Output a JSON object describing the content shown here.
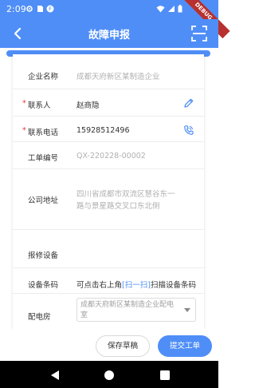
{
  "status_bar": {
    "time": "2:09",
    "icons": [
      "gear-icon",
      "sim-icon",
      "notification-app-icon",
      "wifi-icon",
      "signal-icon",
      "battery-icon"
    ],
    "debug_banner": "DEBUG"
  },
  "appbar": {
    "title": "故障申报",
    "background": "#4f8ef7"
  },
  "form": {
    "company": {
      "label": "企业名称",
      "value": "成都天府新区某制造企业"
    },
    "contact": {
      "label": "联系人",
      "value": "赵商隐",
      "required": "*"
    },
    "phone": {
      "label": "联系电话",
      "value": "15928512496",
      "required": "*"
    },
    "order_no": {
      "label": "工单编号",
      "value": "QX-220228-00002"
    },
    "address": {
      "label": "公司地址",
      "line1": "四川省成都市双流区慧谷东一",
      "line2": "路与景星路交叉口东北侧"
    },
    "device": {
      "label": "报修设备"
    },
    "barcode": {
      "label": "设备条码",
      "pre": "可点击右上角",
      "link": "[扫一扫]",
      "post": "扫描设备条码"
    },
    "substation": {
      "label": "配电房",
      "line1": "成都天府新区某制造企业配电",
      "line2": "室"
    }
  },
  "footer": {
    "draft_label": "保存草稿",
    "submit_label": "提交工单"
  }
}
